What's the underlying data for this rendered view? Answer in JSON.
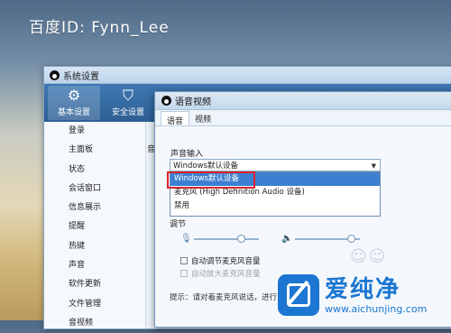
{
  "watermark_top": "百度ID: Fynn_Lee",
  "settings_window": {
    "title": "系统设置",
    "toolbar": [
      {
        "label": "基本设置",
        "icon": "gear-icon",
        "active": true
      },
      {
        "label": "安全设置",
        "icon": "shield-icon",
        "active": false
      }
    ],
    "sidebar_items": [
      "登录",
      "主面板",
      "状态",
      "会话窗口",
      "信息展示",
      "提醒",
      "热键",
      "声音",
      "软件更新",
      "文件管理",
      "音视频"
    ],
    "content_peek": "音"
  },
  "voice_dialog": {
    "title": "语音视频",
    "tabs": [
      "语音",
      "视频"
    ],
    "input_section_label": "声音输入",
    "input_select_value": "Windows默认设备",
    "dropdown_options": [
      "Windows默认设备",
      "麦克风 (High Definition Audio 设备)",
      "禁用"
    ],
    "selected_option_index": 0,
    "adjust_label": "调节",
    "checkbox_auto_adjust": "自动调节麦克风音量",
    "checkbox_auto_amplify": "自动放大麦克风音量",
    "hint_text": "提示：请对着麦克风说话，进行"
  },
  "logo": {
    "brand_cn": "爱纯净",
    "url": "www.aichunjing.com"
  },
  "colors": {
    "toolbar_blue": "#3e78b3",
    "selection_blue": "#3d7fd1",
    "highlight_red": "#d9232d",
    "logo_blue": "#1c76d2"
  }
}
